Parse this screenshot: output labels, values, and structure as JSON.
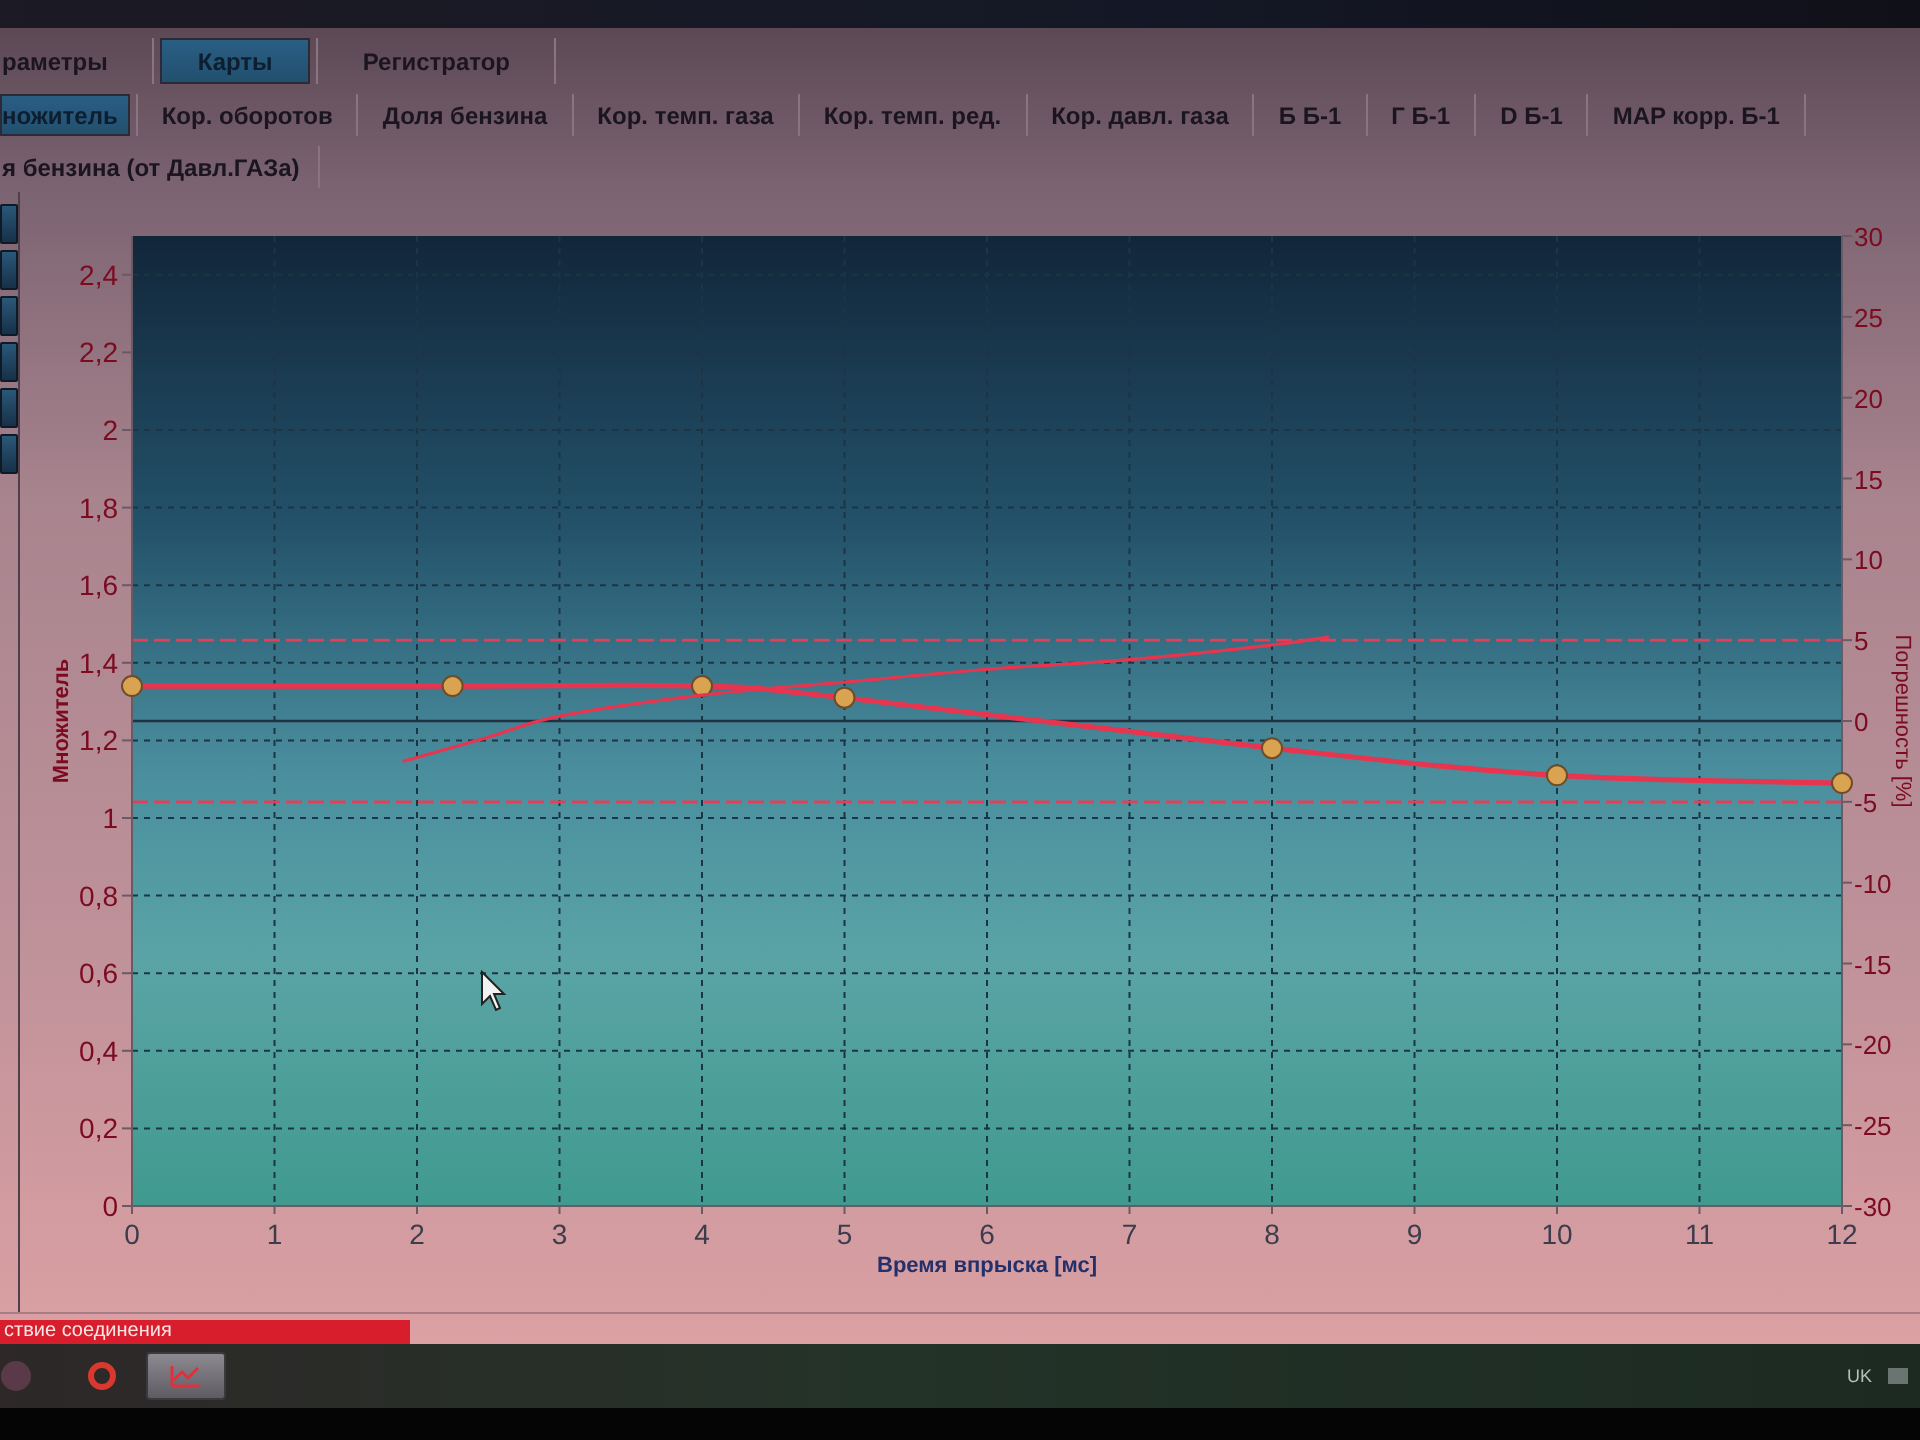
{
  "tabs": [
    {
      "label": "раметры",
      "selected": false
    },
    {
      "label": "Карты",
      "selected": true
    },
    {
      "label": "Регистратор",
      "selected": false
    }
  ],
  "map_tab_rows": [
    [
      {
        "label": "ножитель",
        "selected": true
      },
      {
        "label": "Кор. оборотов",
        "selected": false
      },
      {
        "label": "Доля бензина",
        "selected": false
      },
      {
        "label": "Кор. темп. газа",
        "selected": false
      },
      {
        "label": "Кор. темп. ред.",
        "selected": false
      },
      {
        "label": "Кор. давл. газа",
        "selected": false
      },
      {
        "label": "Б Б-1",
        "selected": false
      },
      {
        "label": "Г Б-1",
        "selected": false
      },
      {
        "label": "D Б-1",
        "selected": false
      },
      {
        "label": "MAP корр. Б-1",
        "selected": false
      }
    ],
    [
      {
        "label": "я бензина (от Давл.ГАЗа)",
        "selected": false
      }
    ]
  ],
  "chart": {
    "chart_data": {
      "type": "line",
      "xlabel": "Время впрыска [мс]",
      "ylabel": "Множитель",
      "y2label": "Погрешность [%]",
      "xlim": [
        0,
        12
      ],
      "ylim": [
        0,
        2.5
      ],
      "y2lim": [
        -30,
        30
      ],
      "xticks": [
        0,
        1,
        2,
        3,
        4,
        5,
        6,
        7,
        8,
        9,
        10,
        11,
        12
      ],
      "yticks": [
        {
          "value": 0,
          "label": "0"
        },
        {
          "value": 0.2,
          "label": "0,2"
        },
        {
          "value": 0.4,
          "label": "0,4"
        },
        {
          "value": 0.6,
          "label": "0,6"
        },
        {
          "value": 0.8,
          "label": "0,8"
        },
        {
          "value": 1,
          "label": "1"
        },
        {
          "value": 1.2,
          "label": "1,2"
        },
        {
          "value": 1.4,
          "label": "1,4"
        },
        {
          "value": 1.6,
          "label": "1,6"
        },
        {
          "value": 1.8,
          "label": "1,8"
        },
        {
          "value": 2,
          "label": "2"
        },
        {
          "value": 2.2,
          "label": "2,2"
        },
        {
          "value": 2.4,
          "label": "2,4"
        }
      ],
      "y2ticks": [
        -30,
        -25,
        -20,
        -15,
        -10,
        -5,
        0,
        5,
        10,
        15,
        20,
        25,
        30
      ],
      "grid": true,
      "series": [
        {
          "color": "#e8354f",
          "marker": "circle",
          "x": [
            0,
            2.25,
            4,
            5,
            8,
            10,
            12
          ],
          "values": [
            1.34,
            1.34,
            1.34,
            1.31,
            1.18,
            1.11,
            1.09
          ]
        },
        {
          "axis": "y2",
          "color": "#e8354f",
          "x": [
            1.9,
            2.5,
            3,
            4,
            5,
            6,
            7,
            8,
            8.4
          ],
          "values": [
            -2.5,
            -1.0,
            0.3,
            1.6,
            2.4,
            3.2,
            3.8,
            4.7,
            5.2
          ]
        }
      ]
    }
  },
  "status_bar": {
    "text": "ствие соединения"
  },
  "taskbar": {
    "language": "UK"
  }
}
